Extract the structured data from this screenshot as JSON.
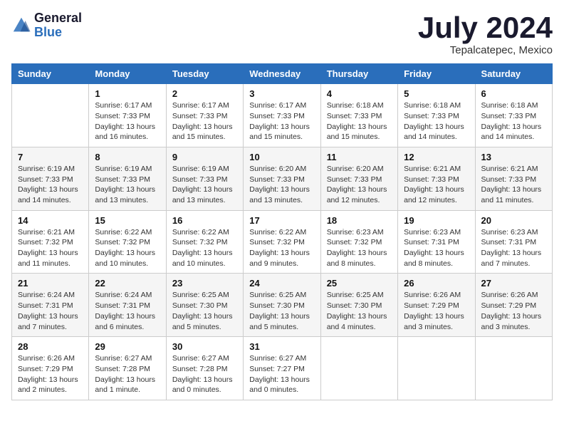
{
  "logo": {
    "general": "General",
    "blue": "Blue"
  },
  "title": {
    "month_year": "July 2024",
    "location": "Tepalcatepec, Mexico"
  },
  "headers": [
    "Sunday",
    "Monday",
    "Tuesday",
    "Wednesday",
    "Thursday",
    "Friday",
    "Saturday"
  ],
  "weeks": [
    [
      {
        "day": "",
        "info": ""
      },
      {
        "day": "1",
        "info": "Sunrise: 6:17 AM\nSunset: 7:33 PM\nDaylight: 13 hours\nand 16 minutes."
      },
      {
        "day": "2",
        "info": "Sunrise: 6:17 AM\nSunset: 7:33 PM\nDaylight: 13 hours\nand 15 minutes."
      },
      {
        "day": "3",
        "info": "Sunrise: 6:17 AM\nSunset: 7:33 PM\nDaylight: 13 hours\nand 15 minutes."
      },
      {
        "day": "4",
        "info": "Sunrise: 6:18 AM\nSunset: 7:33 PM\nDaylight: 13 hours\nand 15 minutes."
      },
      {
        "day": "5",
        "info": "Sunrise: 6:18 AM\nSunset: 7:33 PM\nDaylight: 13 hours\nand 14 minutes."
      },
      {
        "day": "6",
        "info": "Sunrise: 6:18 AM\nSunset: 7:33 PM\nDaylight: 13 hours\nand 14 minutes."
      }
    ],
    [
      {
        "day": "7",
        "info": "Sunrise: 6:19 AM\nSunset: 7:33 PM\nDaylight: 13 hours\nand 14 minutes."
      },
      {
        "day": "8",
        "info": "Sunrise: 6:19 AM\nSunset: 7:33 PM\nDaylight: 13 hours\nand 13 minutes."
      },
      {
        "day": "9",
        "info": "Sunrise: 6:19 AM\nSunset: 7:33 PM\nDaylight: 13 hours\nand 13 minutes."
      },
      {
        "day": "10",
        "info": "Sunrise: 6:20 AM\nSunset: 7:33 PM\nDaylight: 13 hours\nand 13 minutes."
      },
      {
        "day": "11",
        "info": "Sunrise: 6:20 AM\nSunset: 7:33 PM\nDaylight: 13 hours\nand 12 minutes."
      },
      {
        "day": "12",
        "info": "Sunrise: 6:21 AM\nSunset: 7:33 PM\nDaylight: 13 hours\nand 12 minutes."
      },
      {
        "day": "13",
        "info": "Sunrise: 6:21 AM\nSunset: 7:33 PM\nDaylight: 13 hours\nand 11 minutes."
      }
    ],
    [
      {
        "day": "14",
        "info": "Sunrise: 6:21 AM\nSunset: 7:32 PM\nDaylight: 13 hours\nand 11 minutes."
      },
      {
        "day": "15",
        "info": "Sunrise: 6:22 AM\nSunset: 7:32 PM\nDaylight: 13 hours\nand 10 minutes."
      },
      {
        "day": "16",
        "info": "Sunrise: 6:22 AM\nSunset: 7:32 PM\nDaylight: 13 hours\nand 10 minutes."
      },
      {
        "day": "17",
        "info": "Sunrise: 6:22 AM\nSunset: 7:32 PM\nDaylight: 13 hours\nand 9 minutes."
      },
      {
        "day": "18",
        "info": "Sunrise: 6:23 AM\nSunset: 7:32 PM\nDaylight: 13 hours\nand 8 minutes."
      },
      {
        "day": "19",
        "info": "Sunrise: 6:23 AM\nSunset: 7:31 PM\nDaylight: 13 hours\nand 8 minutes."
      },
      {
        "day": "20",
        "info": "Sunrise: 6:23 AM\nSunset: 7:31 PM\nDaylight: 13 hours\nand 7 minutes."
      }
    ],
    [
      {
        "day": "21",
        "info": "Sunrise: 6:24 AM\nSunset: 7:31 PM\nDaylight: 13 hours\nand 7 minutes."
      },
      {
        "day": "22",
        "info": "Sunrise: 6:24 AM\nSunset: 7:31 PM\nDaylight: 13 hours\nand 6 minutes."
      },
      {
        "day": "23",
        "info": "Sunrise: 6:25 AM\nSunset: 7:30 PM\nDaylight: 13 hours\nand 5 minutes."
      },
      {
        "day": "24",
        "info": "Sunrise: 6:25 AM\nSunset: 7:30 PM\nDaylight: 13 hours\nand 5 minutes."
      },
      {
        "day": "25",
        "info": "Sunrise: 6:25 AM\nSunset: 7:30 PM\nDaylight: 13 hours\nand 4 minutes."
      },
      {
        "day": "26",
        "info": "Sunrise: 6:26 AM\nSunset: 7:29 PM\nDaylight: 13 hours\nand 3 minutes."
      },
      {
        "day": "27",
        "info": "Sunrise: 6:26 AM\nSunset: 7:29 PM\nDaylight: 13 hours\nand 3 minutes."
      }
    ],
    [
      {
        "day": "28",
        "info": "Sunrise: 6:26 AM\nSunset: 7:29 PM\nDaylight: 13 hours\nand 2 minutes."
      },
      {
        "day": "29",
        "info": "Sunrise: 6:27 AM\nSunset: 7:28 PM\nDaylight: 13 hours\nand 1 minute."
      },
      {
        "day": "30",
        "info": "Sunrise: 6:27 AM\nSunset: 7:28 PM\nDaylight: 13 hours\nand 0 minutes."
      },
      {
        "day": "31",
        "info": "Sunrise: 6:27 AM\nSunset: 7:27 PM\nDaylight: 13 hours\nand 0 minutes."
      },
      {
        "day": "",
        "info": ""
      },
      {
        "day": "",
        "info": ""
      },
      {
        "day": "",
        "info": ""
      }
    ]
  ]
}
